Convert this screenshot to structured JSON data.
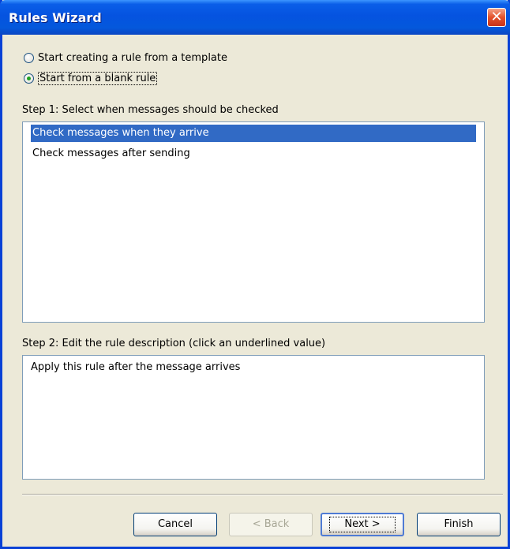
{
  "window": {
    "title": "Rules Wizard",
    "close_label": "✕"
  },
  "options": {
    "template": "Start creating a rule from a template",
    "blank": "Start from a blank rule",
    "selected": "blank"
  },
  "step1": {
    "label": "Step 1: Select when messages should be checked",
    "items": [
      "Check messages when they arrive",
      "Check messages after sending"
    ],
    "selected_index": 0
  },
  "step2": {
    "label": "Step 2: Edit the rule description (click an underlined value)",
    "description": "Apply this rule after the message arrives"
  },
  "buttons": {
    "cancel": "Cancel",
    "back": "< Back",
    "next": "Next >",
    "finish": "Finish"
  },
  "colors": {
    "titlebar": "#0553e0",
    "selection": "#316ac5",
    "dialog_bg": "#ece9d8"
  }
}
